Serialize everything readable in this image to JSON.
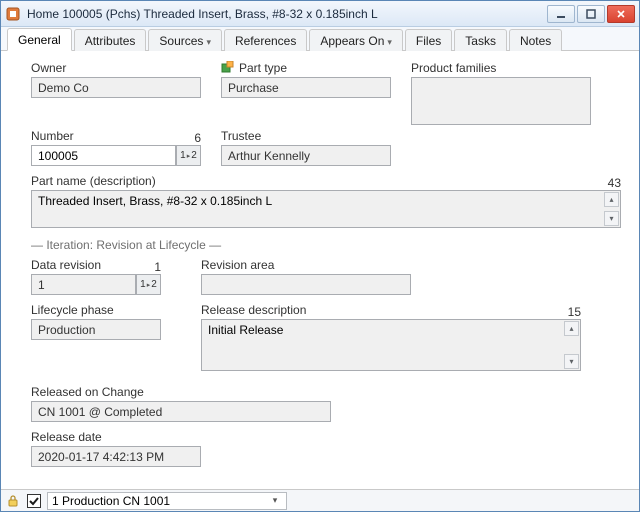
{
  "window": {
    "title": "Home 100005 (Pchs) Threaded Insert, Brass, #8-32 x 0.185inch L"
  },
  "tabs": {
    "general": "General",
    "attributes": "Attributes",
    "sources": "Sources",
    "references": "References",
    "appears_on": "Appears On",
    "files": "Files",
    "tasks": "Tasks",
    "notes": "Notes"
  },
  "labels": {
    "owner": "Owner",
    "part_type": "Part type",
    "product_families": "Product families",
    "number": "Number",
    "trustee": "Trustee",
    "part_name": "Part name (description)",
    "iteration_section": "— Iteration: Revision at Lifecycle —",
    "data_revision": "Data revision",
    "revision_area": "Revision area",
    "lifecycle_phase": "Lifecycle phase",
    "release_description": "Release description",
    "released_on_change": "Released on Change",
    "release_date": "Release date",
    "number_count": "6",
    "part_name_count": "43",
    "data_revision_count": "1",
    "release_desc_count": "15"
  },
  "values": {
    "owner": "Demo Co",
    "part_type": "Purchase",
    "number": "100005",
    "trustee": "Arthur Kennelly",
    "part_name": "Threaded Insert, Brass, #8-32 x 0.185inch L",
    "data_revision": "1",
    "revision_area": "",
    "lifecycle_phase": "Production",
    "release_description": "Initial Release",
    "released_on_change": "CN 1001 @ Completed",
    "release_date": "2020-01-17 4:42:13 PM",
    "product_families": ""
  },
  "status": {
    "dropdown": "1 Production CN 1001"
  },
  "btn": {
    "onetwo_a": "1",
    "onetwo_b": "2"
  }
}
